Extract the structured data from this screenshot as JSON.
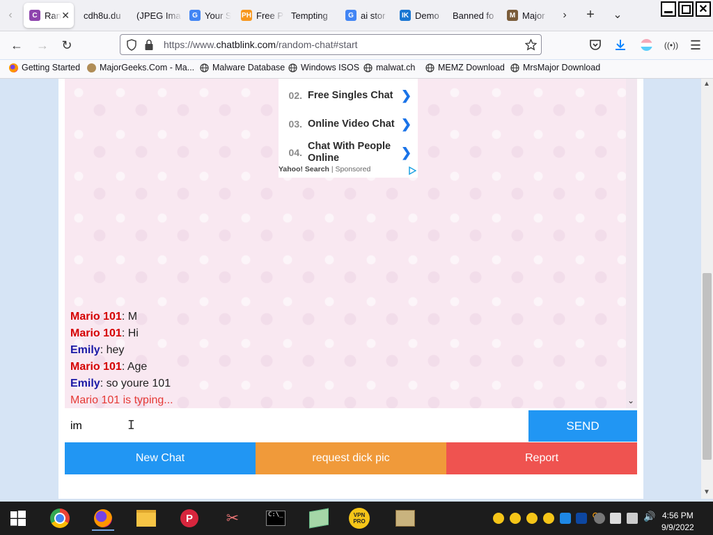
{
  "browser": {
    "tabs": [
      {
        "label": "Ran",
        "favicon": "C",
        "color": "#8e44ad",
        "active": true
      },
      {
        "label": "cdh8u.du",
        "favicon": "",
        "color": "",
        "active": false
      },
      {
        "label": "(JPEG Ima",
        "favicon": "",
        "color": "",
        "active": false
      },
      {
        "label": "Your S",
        "favicon": "G",
        "color": "#4285f4",
        "active": false
      },
      {
        "label": "Free P",
        "favicon": "PH",
        "color": "#f7971e",
        "active": false
      },
      {
        "label": "Tempting",
        "favicon": "",
        "color": "",
        "active": false
      },
      {
        "label": "ai stor",
        "favicon": "G",
        "color": "#4285f4",
        "active": false
      },
      {
        "label": "Demo",
        "favicon": "IK",
        "color": "#1976d2",
        "active": false
      },
      {
        "label": "Banned fo",
        "favicon": "",
        "color": "",
        "active": false
      },
      {
        "label": "Major",
        "favicon": "M",
        "color": "#7a5c3a",
        "active": false
      }
    ],
    "url_domain": "https://www.",
    "url_host": "chatblink.com",
    "url_path": "/random-chat#start",
    "bookmarks": [
      {
        "label": "Getting Started",
        "icon": "firefox-icon"
      },
      {
        "label": "MajorGeeks.Com - Ma...",
        "icon": "majorgeeks-icon"
      },
      {
        "label": "Malware Database",
        "icon": "globe-icon"
      },
      {
        "label": "Windows ISOS",
        "icon": "globe-icon"
      },
      {
        "label": "malwat.ch",
        "icon": "globe-icon"
      },
      {
        "label": "MEMZ Download",
        "icon": "globe-icon"
      },
      {
        "label": "MrsMajor Download",
        "icon": "globe-icon"
      }
    ]
  },
  "ad": {
    "items": [
      {
        "num": "02.",
        "label": "Free Singles Chat"
      },
      {
        "num": "03.",
        "label": "Online Video Chat"
      },
      {
        "num": "04.",
        "label": "Chat With People Online"
      }
    ],
    "footer_brand": "Yahoo! Search",
    "footer_sep": " | ",
    "footer_sponsored": "Sponsored"
  },
  "chat": {
    "messages": [
      {
        "who": "Mario 101",
        "text": ": M",
        "color": "#d50000"
      },
      {
        "who": "Mario 101",
        "text": ": Hi",
        "color": "#d50000"
      },
      {
        "who": "Emily",
        "text": ": hey",
        "color": "#1a1aa6"
      },
      {
        "who": "Mario 101",
        "text": ": Age",
        "color": "#d50000"
      },
      {
        "who": "Emily",
        "text": ": so youre 101",
        "color": "#1a1aa6"
      }
    ],
    "typing": "Mario 101 is typing...",
    "input_value": "im",
    "send_label": "SEND",
    "actions": [
      {
        "label": "New Chat",
        "color": "#2196f3"
      },
      {
        "label": "request dick pic",
        "color": "#f09a3a"
      },
      {
        "label": "Report",
        "color": "#ef5350"
      }
    ]
  },
  "taskbar": {
    "time": "4:56 PM",
    "date": "9/9/2022"
  }
}
